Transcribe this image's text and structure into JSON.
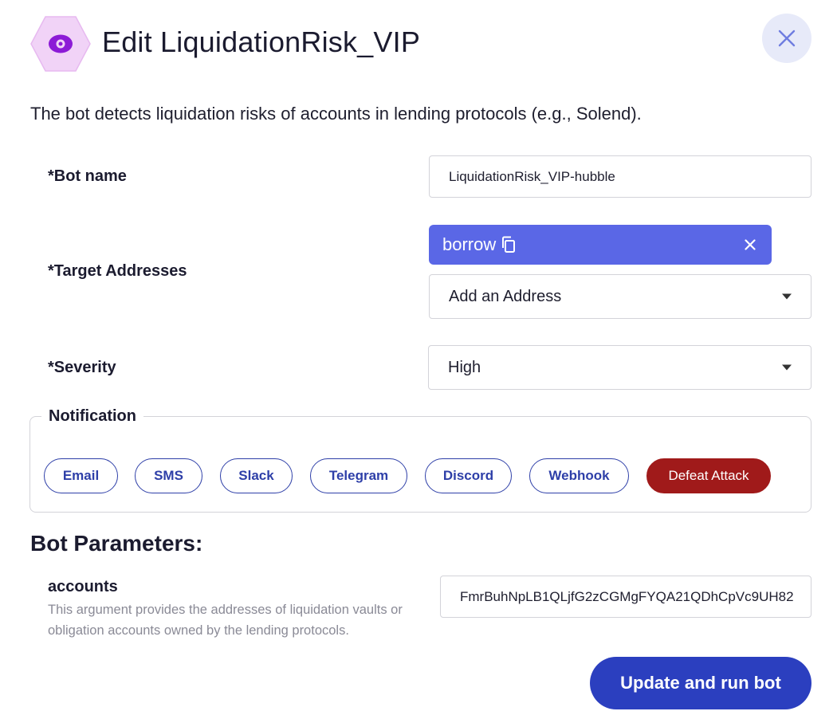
{
  "header": {
    "title": "Edit LiquidationRisk_VIP",
    "icon": "eye-icon",
    "icon_color": "#8c1bd6",
    "icon_bg": "#f1d3f7",
    "close_icon": "close-icon"
  },
  "description": "The bot detects liquidation risks of accounts in lending protocols (e.g., Solend).",
  "form": {
    "bot_name": {
      "label": "*Bot name",
      "value": "LiquidationRisk_VIP-hubble"
    },
    "target_addresses": {
      "label": "*Target Addresses",
      "chips": [
        {
          "label": "borrow"
        }
      ],
      "placeholder": "Add an Address"
    },
    "severity": {
      "label": "*Severity",
      "value": "High"
    }
  },
  "notification": {
    "legend": "Notification",
    "channels": [
      {
        "label": "Email"
      },
      {
        "label": "SMS"
      },
      {
        "label": "Slack"
      },
      {
        "label": "Telegram"
      },
      {
        "label": "Discord"
      },
      {
        "label": "Webhook"
      },
      {
        "label": "Defeat Attack"
      }
    ]
  },
  "parameters": {
    "title": "Bot Parameters:",
    "items": [
      {
        "name": "accounts",
        "description": "This argument provides the addresses of liquidation vaults or obligation accounts owned by the lending protocols.",
        "value": "FmrBuhNpLB1QLjfG2zCGMgFYQA21QDhCpVc9UH82"
      }
    ]
  },
  "actions": {
    "submit_label": "Update and run bot"
  },
  "colors": {
    "primary": "#2b3fbf",
    "chip": "#5a67e6",
    "danger": "#a01a1a",
    "close_bg": "#e7eaf9",
    "outline": "#2e3fa8"
  }
}
